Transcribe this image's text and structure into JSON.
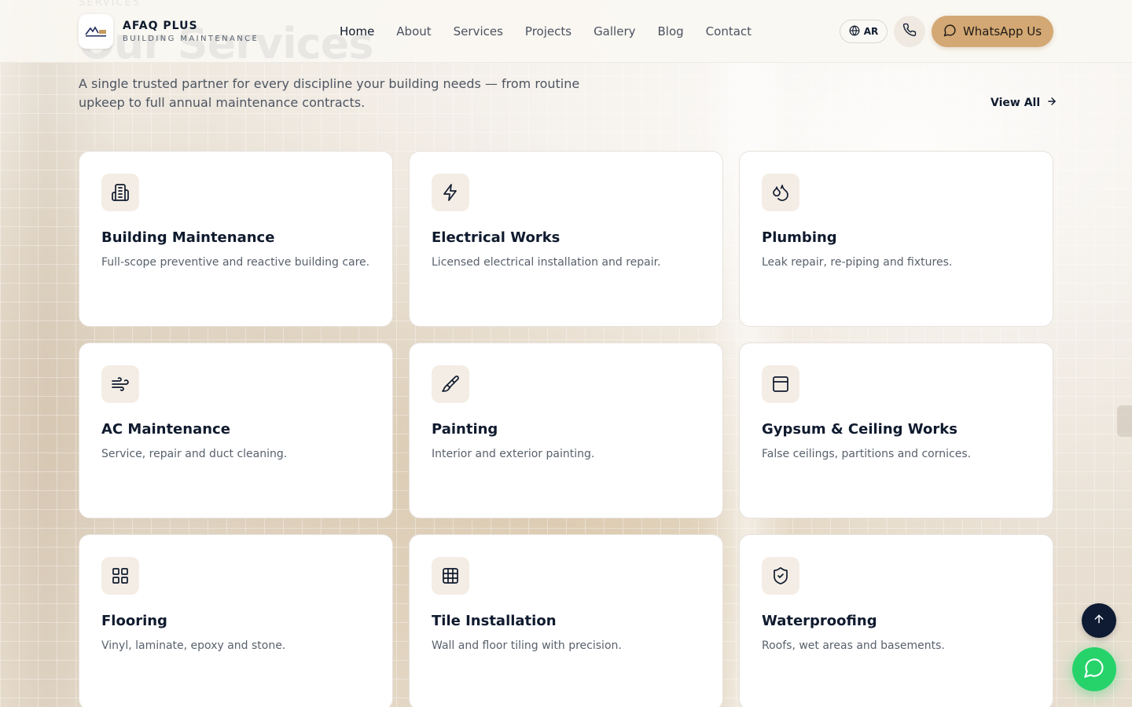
{
  "brand": {
    "name": "AFAQ PLUS",
    "tagline": "BUILDING MAINTENANCE"
  },
  "nav": {
    "items": [
      {
        "label": "Home",
        "active": true
      },
      {
        "label": "About",
        "active": false
      },
      {
        "label": "Services",
        "active": false
      },
      {
        "label": "Projects",
        "active": false
      },
      {
        "label": "Gallery",
        "active": false
      },
      {
        "label": "Blog",
        "active": false
      },
      {
        "label": "Contact",
        "active": false
      }
    ]
  },
  "header": {
    "lang_label": "AR",
    "whatsapp_label": "WhatsApp Us"
  },
  "section": {
    "kicker": "SERVICES",
    "title": "Our Services",
    "intro": "A single trusted partner for every discipline your building needs — from routine upkeep to full annual maintenance contracts.",
    "view_all": "View All"
  },
  "services": [
    {
      "title": "Building Maintenance",
      "desc": "Full-scope preventive and reactive building care.",
      "icon": "building-icon"
    },
    {
      "title": "Electrical Works",
      "desc": "Licensed electrical installation and repair.",
      "icon": "lightning-icon"
    },
    {
      "title": "Plumbing",
      "desc": "Leak repair, re-piping and fixtures.",
      "icon": "droplets-icon"
    },
    {
      "title": "AC Maintenance",
      "desc": "Service, repair and duct cleaning.",
      "icon": "wind-icon"
    },
    {
      "title": "Painting",
      "desc": "Interior and exterior painting.",
      "icon": "paintbrush-icon"
    },
    {
      "title": "Gypsum & Ceiling Works",
      "desc": "False ceilings, partitions and cornices.",
      "icon": "panel-icon"
    },
    {
      "title": "Flooring",
      "desc": "Vinyl, laminate, epoxy and stone.",
      "icon": "grid-icon"
    },
    {
      "title": "Tile Installation",
      "desc": "Wall and floor tiling with precision.",
      "icon": "tiles-icon"
    },
    {
      "title": "Waterproofing",
      "desc": "Roofs, wet areas and basements.",
      "icon": "shield-check-icon"
    }
  ],
  "colors": {
    "accent": "#d3a874",
    "navy": "#0f1b33",
    "whatsapp": "#26d36a"
  }
}
